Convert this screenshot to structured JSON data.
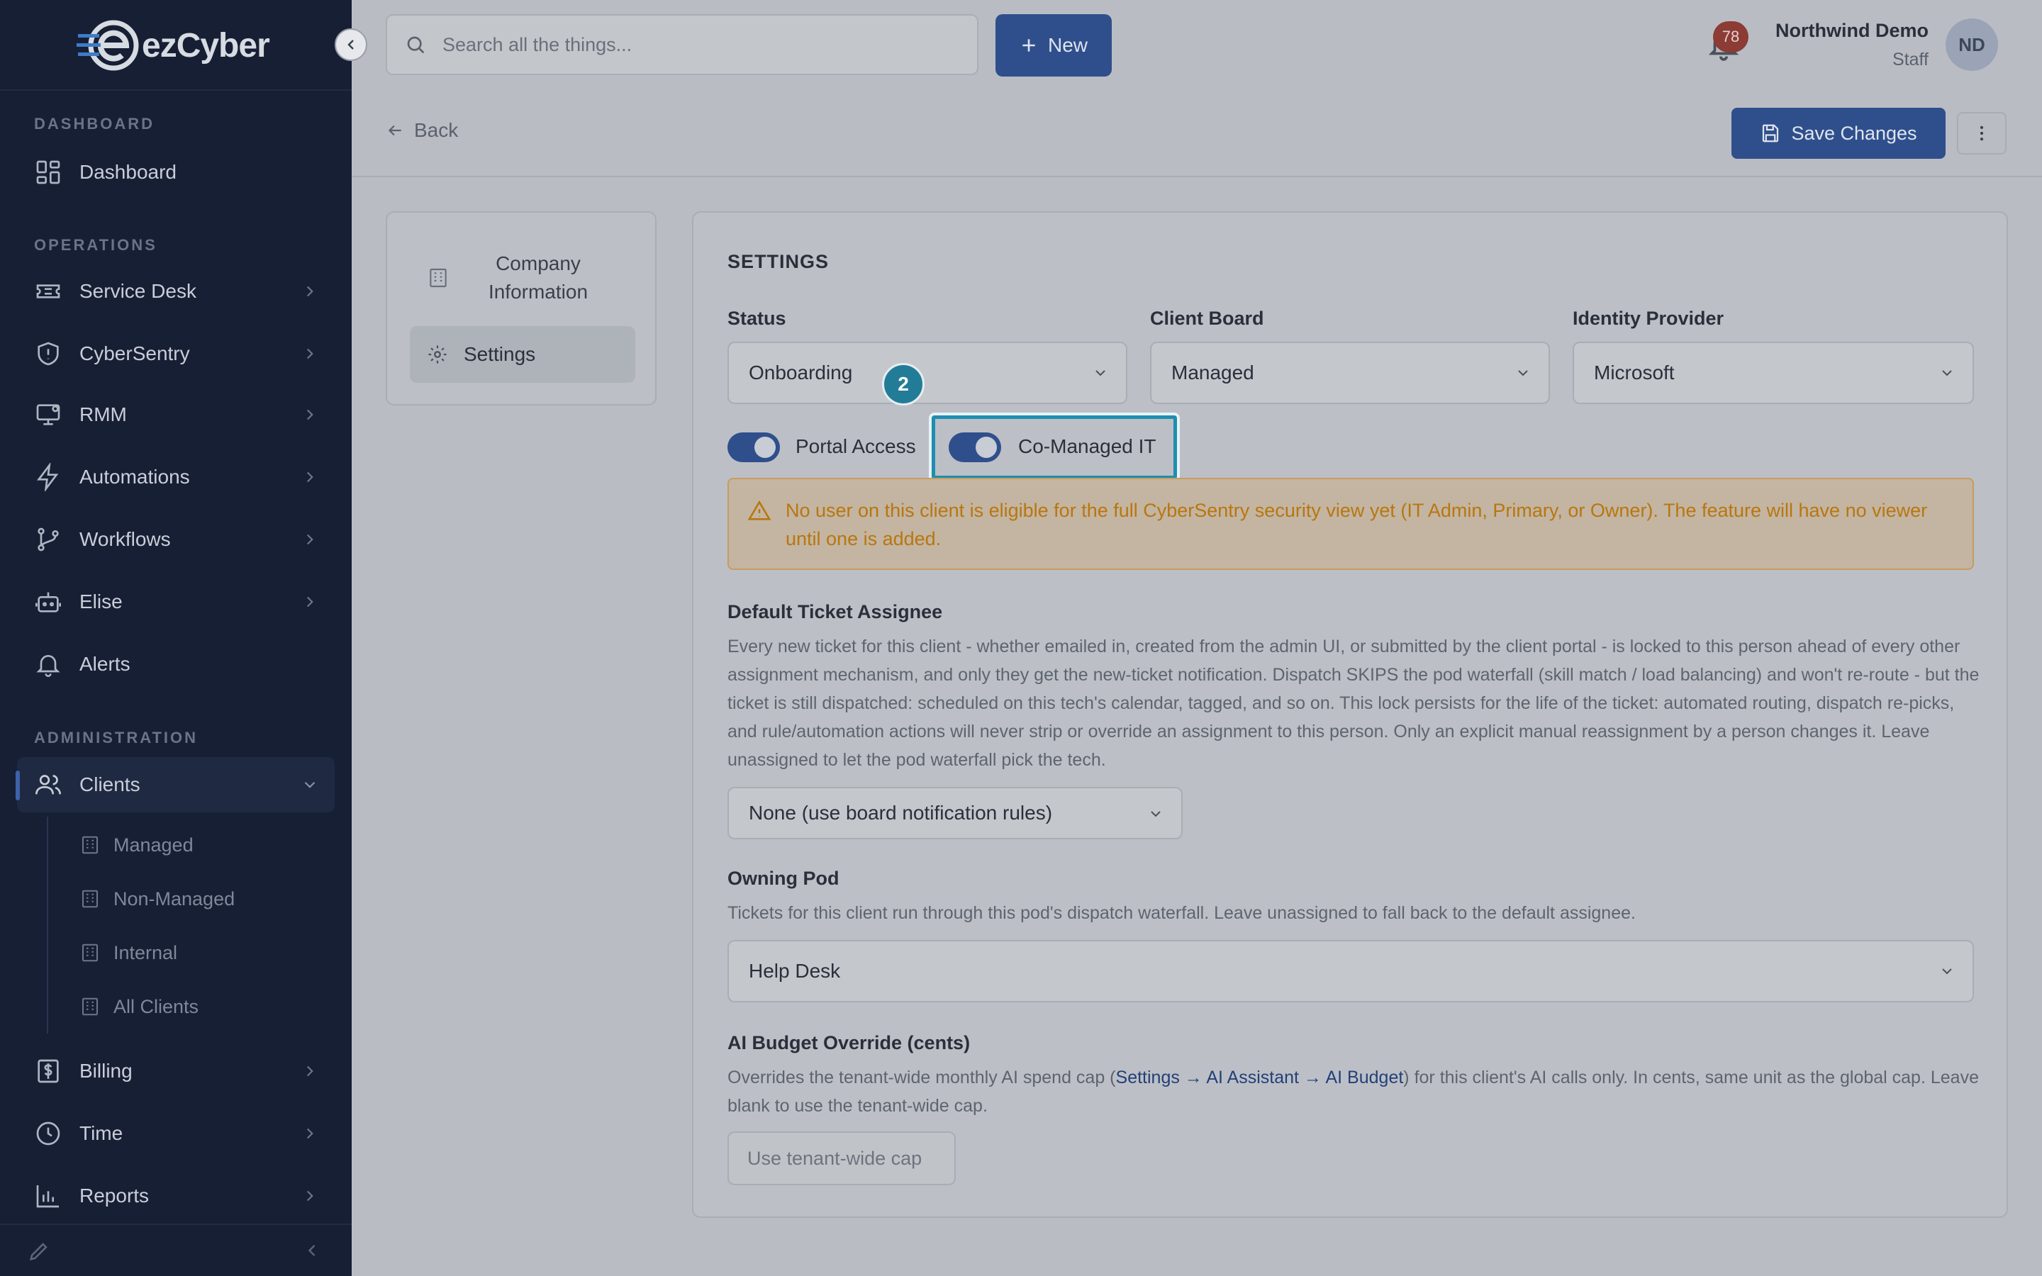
{
  "app": {
    "logo_text": "ezCyber"
  },
  "sidebar": {
    "sections": {
      "dashboard": "DASHBOARD",
      "operations": "OPERATIONS",
      "administration": "ADMINISTRATION"
    },
    "items": [
      {
        "label": "Dashboard",
        "icon": "grid-icon"
      },
      {
        "label": "Service Desk",
        "icon": "ticket-icon"
      },
      {
        "label": "CyberSentry",
        "icon": "shield-icon"
      },
      {
        "label": "RMM",
        "icon": "monitor-icon"
      },
      {
        "label": "Automations",
        "icon": "bolt-icon"
      },
      {
        "label": "Workflows",
        "icon": "branch-icon"
      },
      {
        "label": "Elise",
        "icon": "robot-icon"
      },
      {
        "label": "Alerts",
        "icon": "bell-icon"
      },
      {
        "label": "Clients",
        "icon": "users-icon"
      },
      {
        "label": "Billing",
        "icon": "dollar-icon"
      },
      {
        "label": "Time",
        "icon": "clock-icon"
      },
      {
        "label": "Reports",
        "icon": "bar-chart-icon"
      }
    ],
    "clients_sub": [
      {
        "label": "Managed"
      },
      {
        "label": "Non-Managed"
      },
      {
        "label": "Internal"
      },
      {
        "label": "All Clients"
      }
    ]
  },
  "topbar": {
    "search_placeholder": "Search all the things...",
    "new_label": "New",
    "notification_count": "78",
    "user_name": "Northwind Demo",
    "user_role": "Staff",
    "avatar_initials": "ND"
  },
  "header": {
    "back_label": "Back",
    "save_label": "Save Changes"
  },
  "nav": {
    "company_information": "Company Information",
    "settings": "Settings"
  },
  "settings": {
    "title": "SETTINGS",
    "status": {
      "label": "Status",
      "value": "Onboarding"
    },
    "client_board": {
      "label": "Client Board",
      "value": "Managed"
    },
    "identity_provider": {
      "label": "Identity Provider",
      "value": "Microsoft"
    },
    "portal_access": {
      "label": "Portal Access",
      "enabled": true
    },
    "co_managed": {
      "label": "Co-Managed IT",
      "enabled": true
    },
    "step_badge": "2",
    "warning": "No user on this client is eligible for the full CyberSentry security view yet (IT Admin, Primary, or Owner). The feature will have no viewer until one is added.",
    "default_assignee": {
      "label": "Default Ticket Assignee",
      "description": "Every new ticket for this client - whether emailed in, created from the admin UI, or submitted by the client portal - is locked to this person ahead of every other assignment mechanism, and only they get the new-ticket notification. Dispatch SKIPS the pod waterfall (skill match / load balancing) and won't re-route - but the ticket is still dispatched: scheduled on this tech's calendar, tagged, and so on. This lock persists for the life of the ticket: automated routing, dispatch re-picks, and rule/automation actions will never strip or override an assignment to this person. Only an explicit manual reassignment by a person changes it. Leave unassigned to let the pod waterfall pick the tech.",
      "value": "None (use board notification rules)"
    },
    "owning_pod": {
      "label": "Owning Pod",
      "description": "Tickets for this client run through this pod's dispatch waterfall. Leave unassigned to fall back to the default assignee.",
      "value": "Help Desk"
    },
    "ai_budget": {
      "label": "AI Budget Override (cents)",
      "desc_before": "Overrides the tenant-wide monthly AI spend cap (",
      "desc_link": "Settings → AI Assistant → AI Budget",
      "desc_after": ") for this client's AI calls only. In cents, same unit as the global cap. Leave blank to use the tenant-wide cap.",
      "placeholder": "Use tenant-wide cap"
    }
  },
  "colors": {
    "sidebar_bg": "#171f35",
    "primary": "#2f4f8c",
    "warning_text": "#b9760e",
    "highlight": "#1f8eb0"
  }
}
